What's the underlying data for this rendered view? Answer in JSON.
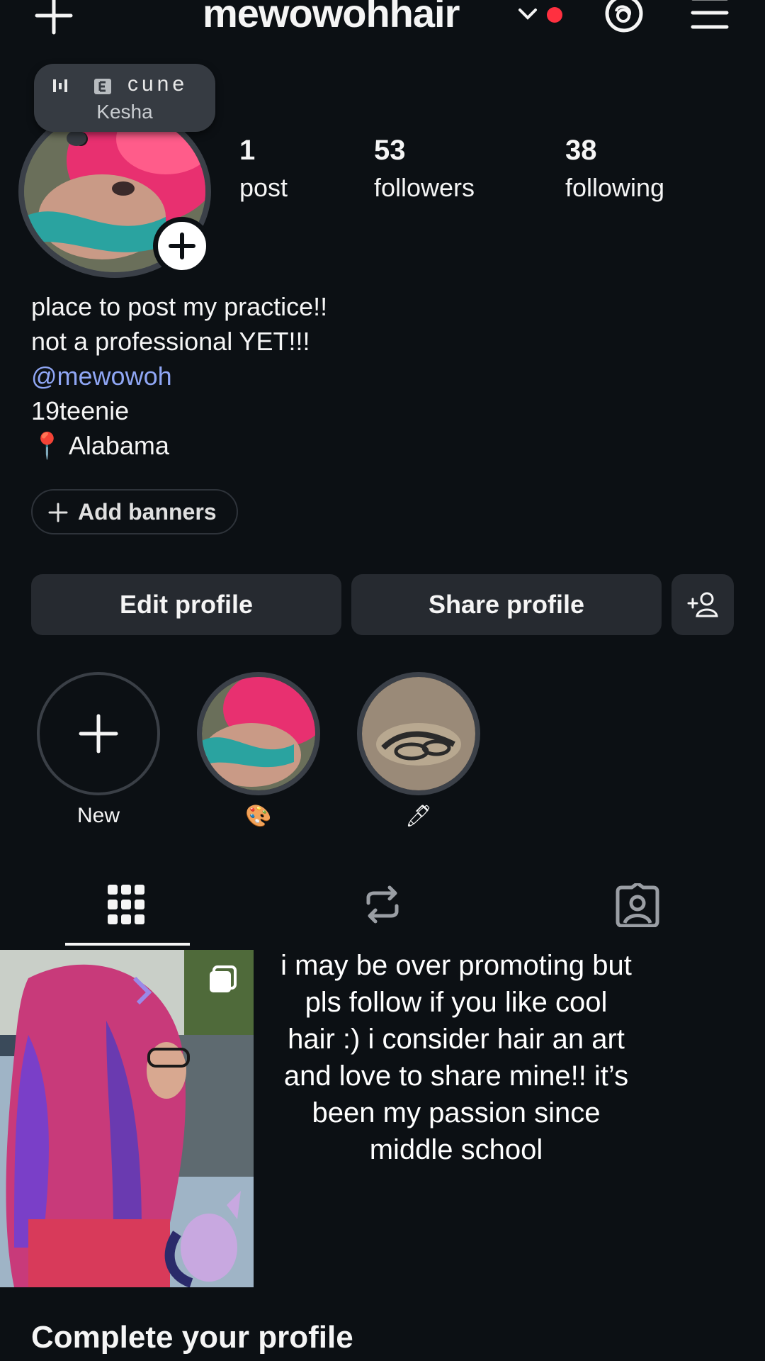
{
  "header": {
    "username": "mewowohhair",
    "icons": [
      "plus-icon",
      "chevron-down-icon",
      "notification-dot",
      "threads-icon",
      "menu-icon"
    ],
    "dot_color": "#ff3040"
  },
  "note": {
    "line1": "cune",
    "artist": "Kesha"
  },
  "stats": [
    {
      "value": "1",
      "label": "post"
    },
    {
      "value": "53",
      "label": "followers"
    },
    {
      "value": "38",
      "label": "following"
    }
  ],
  "bio": {
    "line1": "place to post my practice!!",
    "line2": "not a professional YET!!!",
    "mention": "@mewowoh",
    "line4": "19teenie",
    "location_pin": "📍",
    "location": "Alabama"
  },
  "banner_button": "Add banners",
  "buttons": {
    "edit": "Edit profile",
    "share": "Share profile"
  },
  "highlights": [
    {
      "label": "New"
    },
    {
      "label": "🎨"
    },
    {
      "label": "🖊"
    }
  ],
  "post_caption": "i may be over promoting but pls follow if you like cool hair :) i consider hair an art and love to share mine!! it’s been my passion since middle school",
  "complete_profile": "Complete your profile",
  "colors": {
    "background": "#0c1014",
    "button": "#262a30",
    "mention": "#8fa6f4"
  }
}
